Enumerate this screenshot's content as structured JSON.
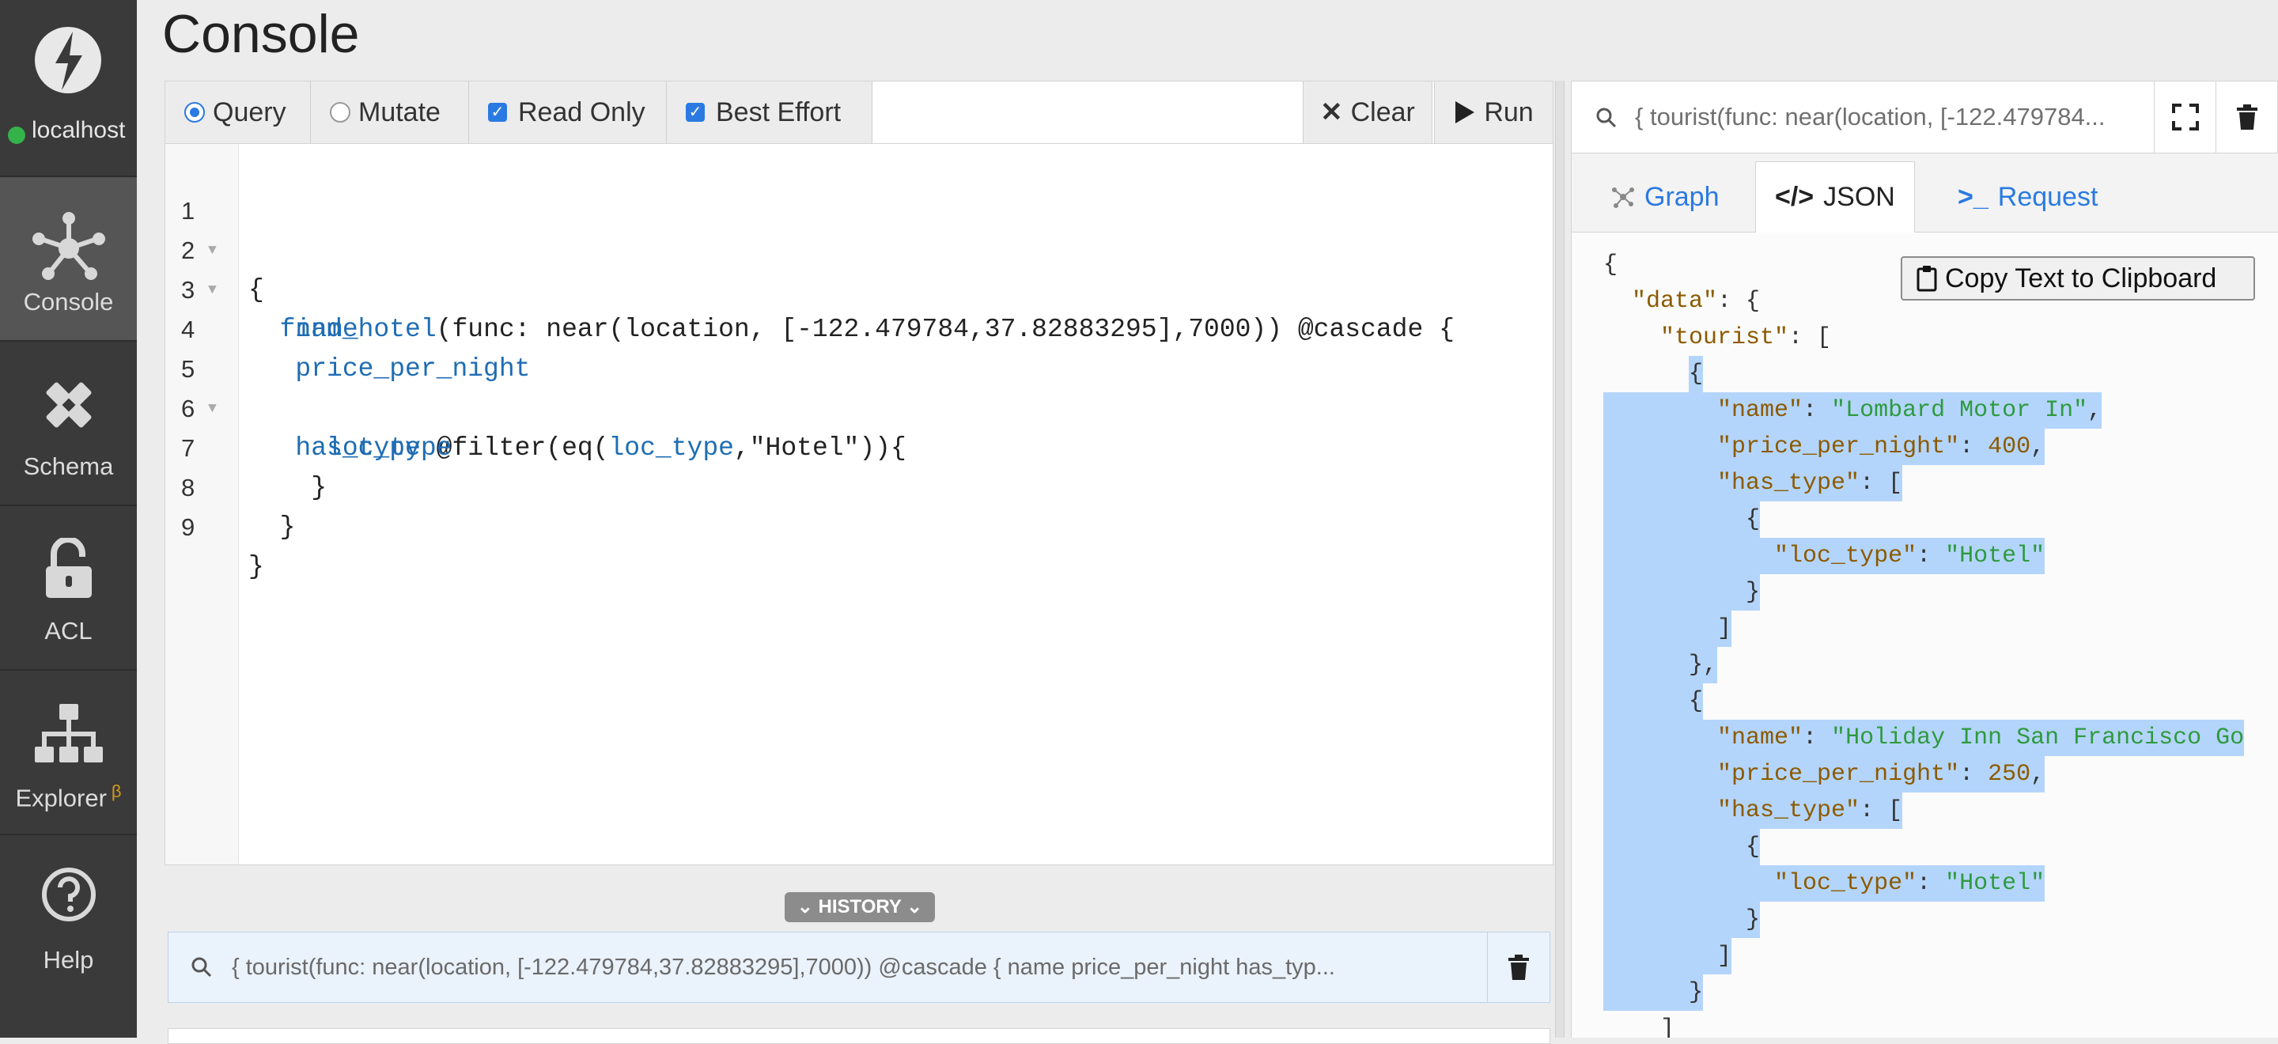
{
  "sidebar": {
    "host": "localhost",
    "items": [
      {
        "label": "Console",
        "icon": "console-hub-icon"
      },
      {
        "label": "Schema",
        "icon": "pencil-ruler-icon"
      },
      {
        "label": "ACL",
        "icon": "unlock-icon"
      },
      {
        "label": "Explorer",
        "icon": "hierarchy-icon",
        "badge": "β"
      },
      {
        "label": "Help",
        "icon": "question-circle-icon"
      }
    ]
  },
  "page": {
    "title": "Console"
  },
  "toolbar": {
    "query": "Query",
    "mutate": "Mutate",
    "read_only": "Read Only",
    "best_effort": "Best Effort",
    "clear": "Clear",
    "run": "Run"
  },
  "editor": {
    "lines": [
      {
        "n": "1",
        "text": "{"
      },
      {
        "n": "2",
        "text": "  find_hotel(func: near(location, [-122.479784,37.82883295],7000)) @cascade {"
      },
      {
        "n": "3",
        "text": "   name"
      },
      {
        "n": "4",
        "text": "   price_per_night"
      },
      {
        "n": "5",
        "text": "   has_type @filter(eq(loc_type,\"Hotel\")){"
      },
      {
        "n": "6",
        "text": "     loc_type"
      },
      {
        "n": "7",
        "text": "    }"
      },
      {
        "n": "8",
        "text": "  }"
      },
      {
        "n": "9",
        "text": "}"
      }
    ]
  },
  "history": {
    "tab_label": "HISTORY",
    "entry": "{ tourist(func: near(location, [-122.479784,37.82883295],7000)) @cascade { name price_per_night has_typ..."
  },
  "result": {
    "query_text": "{ tourist(func: near(location, [-122.479784...",
    "tabs": {
      "graph": "Graph",
      "json": "JSON",
      "request": "Request"
    },
    "copy_label": "Copy Text to Clipboard",
    "json_lines": [
      "{",
      "  \"data\": {",
      "    \"tourist\": [",
      "      {",
      "        \"name\": \"Lombard Motor In\",",
      "        \"price_per_night\": 400,",
      "        \"has_type\": [",
      "          {",
      "            \"loc_type\": \"Hotel\"",
      "          }",
      "        ]",
      "      },",
      "      {",
      "        \"name\": \"Holiday Inn San Francisco Go",
      "        \"price_per_night\": 250,",
      "        \"has_type\": [",
      "          {",
      "            \"loc_type\": \"Hotel\"",
      "          }",
      "        ]",
      "      }",
      "    ]"
    ]
  },
  "colors": {
    "accent": "#2a7ae2",
    "sidebar": "#3a3a3a",
    "selection": "#b4d5fb",
    "status": "#36b24a"
  }
}
